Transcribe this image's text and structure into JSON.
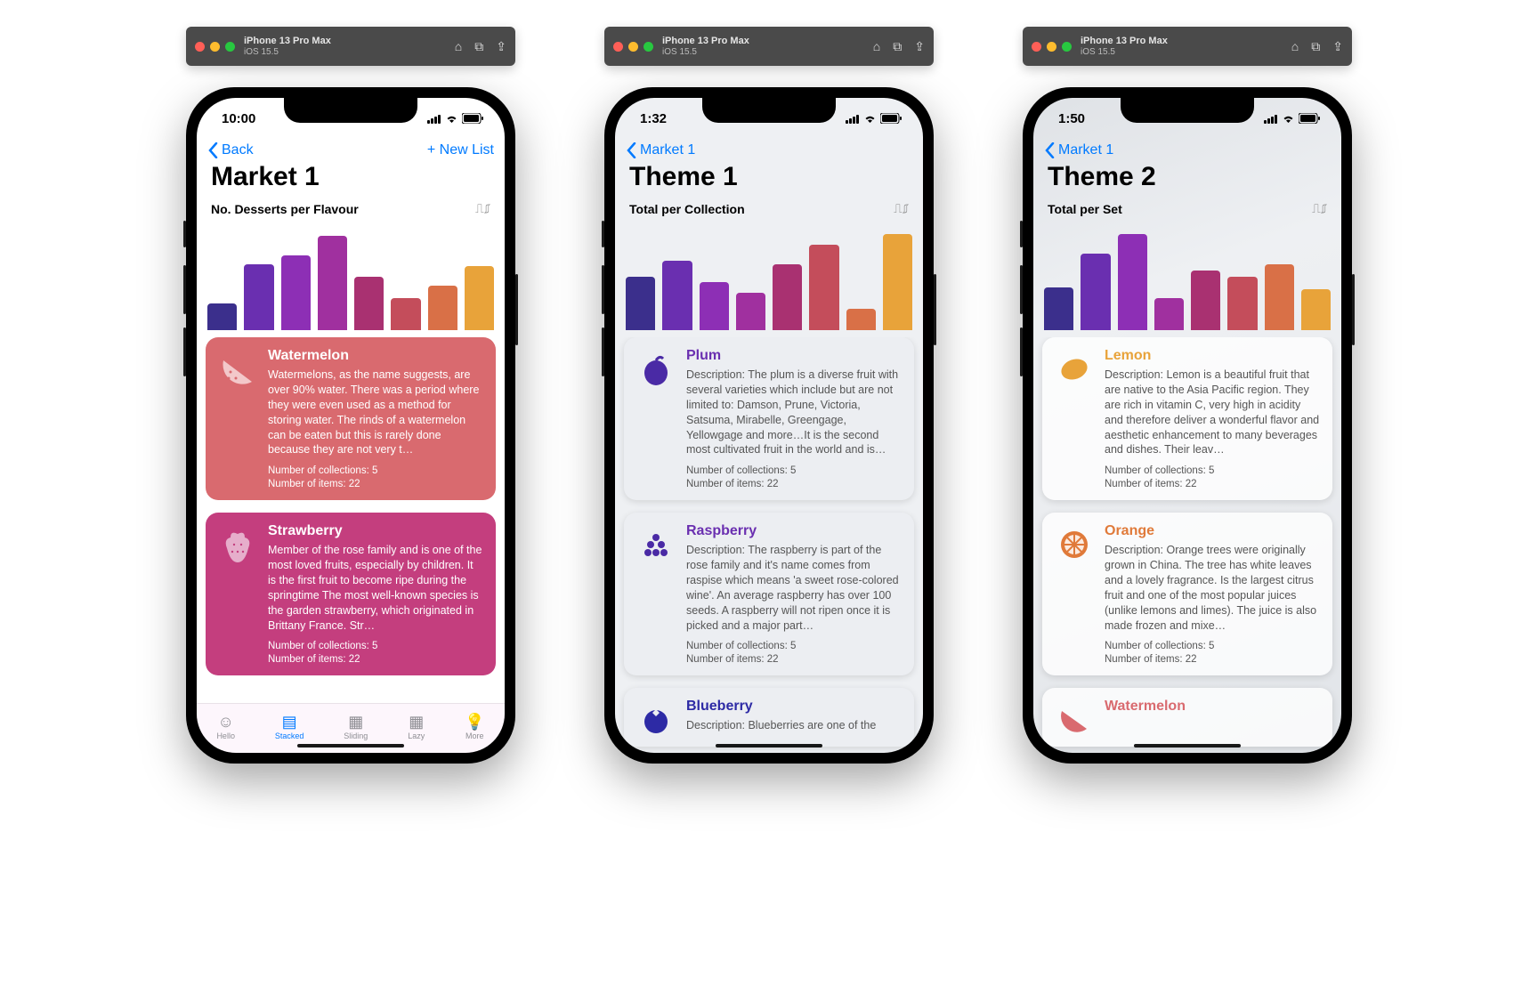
{
  "simbar": {
    "device": "iPhone 13 Pro Max",
    "os": "iOS 15.5"
  },
  "chart_data": [
    {
      "type": "bar",
      "title": "No. Desserts per Flavour",
      "ylim": [
        0,
        100
      ],
      "values": [
        25,
        62,
        70,
        88,
        50,
        30,
        42,
        60
      ],
      "colors": [
        "#3b2f8c",
        "#6a2fb0",
        "#8d2fb5",
        "#a0309f",
        "#a93171",
        "#c44d5b",
        "#d97047",
        "#e8a33a"
      ]
    },
    {
      "type": "bar",
      "title": "Total per Collection",
      "ylim": [
        0,
        100
      ],
      "values": [
        50,
        65,
        45,
        35,
        62,
        80,
        20,
        90
      ],
      "colors": [
        "#3b2f8c",
        "#6a2fb0",
        "#8d2fb5",
        "#a0309f",
        "#a93171",
        "#c44d5b",
        "#d97047",
        "#e8a33a"
      ]
    },
    {
      "type": "bar",
      "title": "Total per Set",
      "ylim": [
        0,
        100
      ],
      "values": [
        40,
        72,
        90,
        30,
        56,
        50,
        62,
        38
      ],
      "colors": [
        "#3b2f8c",
        "#6a2fb0",
        "#8d2fb5",
        "#a0309f",
        "#a93171",
        "#c44d5b",
        "#d97047",
        "#e8a33a"
      ]
    }
  ],
  "screens": [
    {
      "time": "10:00",
      "back": "Back",
      "action": "+ New List",
      "title": "Market 1",
      "section": "No. Desserts per Flavour",
      "tabbar": [
        {
          "label": "Hello",
          "icon": "☺"
        },
        {
          "label": "Stacked",
          "icon": "≣"
        },
        {
          "label": "Sliding",
          "icon": "▦"
        },
        {
          "label": "Lazy",
          "icon": "▦"
        },
        {
          "label": "More",
          "icon": "●"
        }
      ],
      "cards": [
        {
          "title": "Watermelon",
          "color": "#d96a6f",
          "desc": "Watermelons, as the name suggests, are over 90% water.  There was a period where they were even used as a method for storing water.  The rinds of a watermelon can be eaten but this is rarely done because they are not very t…",
          "meta1": "Number of collections: 5",
          "meta2": "Number of items: 22"
        },
        {
          "title": "Strawberry",
          "color": "#c43e7e",
          "desc": "Member of the rose family and is one of the most loved fruits, especially by children.  It is the first fruit to become ripe during the springtime The most well-known species is the garden strawberry, which originated in Brittany France.  Str…",
          "meta1": "Number of collections: 5",
          "meta2": "Number of items: 22"
        }
      ]
    },
    {
      "time": "1:32",
      "back": "Market 1",
      "title": "Theme 1",
      "section": "Total per Collection",
      "cards": [
        {
          "title": "Plum",
          "accent": "#6a2fb0",
          "desc": "Description: The plum is a diverse fruit with several varieties which include but are not limited to: Damson, Prune, Victoria, Satsuma, Mirabelle, Greengage, Yellowgage and more…It is the second most cultivated fruit in the world and is…",
          "meta1": "Number of collections: 5",
          "meta2": "Number of items: 22"
        },
        {
          "title": "Raspberry",
          "accent": "#4a2aa5",
          "desc": "Description: The raspberry is part of the rose family and it's name comes from raspise which means 'a sweet rose-colored wine'.  An average raspberry has over 100 seeds.  A raspberry will not ripen once it is picked and a major part…",
          "meta1": "Number of collections: 5",
          "meta2": "Number of items: 22"
        },
        {
          "title": "Blueberry",
          "accent": "#2d2aa5",
          "desc": "Description: Blueberries are one of the",
          "meta1": "",
          "meta2": ""
        }
      ]
    },
    {
      "time": "1:50",
      "back": "Market 1",
      "title": "Theme 2",
      "section": "Total per Set",
      "cards": [
        {
          "title": "Lemon",
          "accent": "#e8a33a",
          "desc": "Description: Lemon is a beautiful fruit that are native to the Asia Pacific region.  They are rich in vitamin C, very high in acidity and therefore deliver a wonderful flavor and aesthetic enhancement to many beverages and dishes.  Their leav…",
          "meta1": "Number of collections: 5",
          "meta2": "Number of items: 22"
        },
        {
          "title": "Orange",
          "accent": "#e07a3a",
          "desc": "Description: Orange trees were originally grown in China.  The tree has white leaves and a lovely fragrance.  Is the largest citrus fruit and one of the most popular juices (unlike lemons and limes).  The juice is also made frozen and mixe…",
          "meta1": "Number of collections: 5",
          "meta2": "Number of items: 22"
        },
        {
          "title": "Watermelon",
          "accent": "#d96a6f",
          "desc": "",
          "meta1": "",
          "meta2": ""
        }
      ]
    }
  ]
}
